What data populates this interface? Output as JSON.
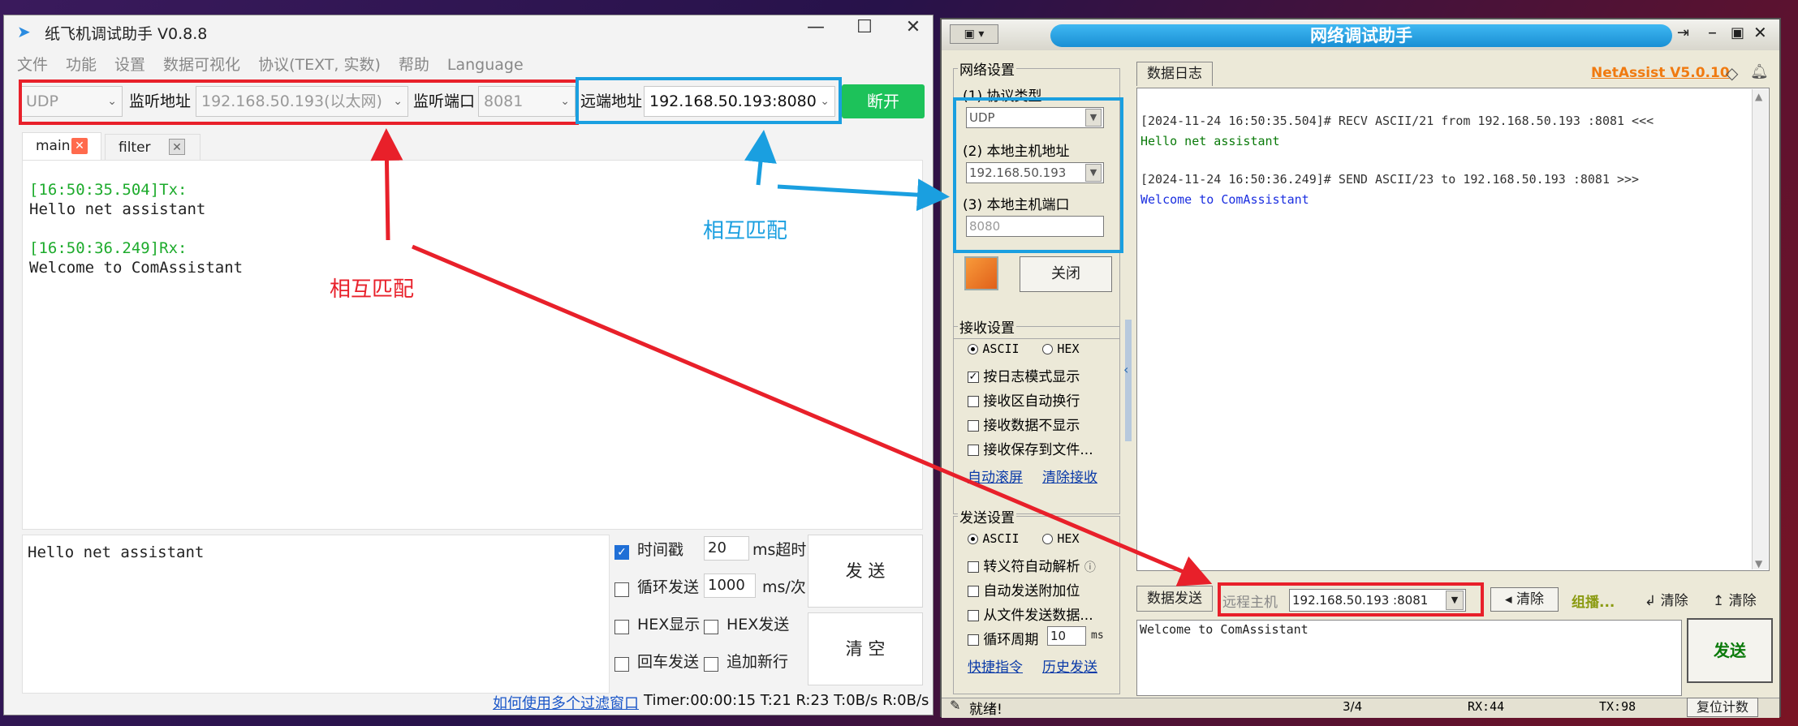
{
  "left": {
    "title": "纸飞机调试助手 V0.8.8",
    "menu": [
      "文件",
      "功能",
      "设置",
      "数据可视化",
      "协议(TEXT, 实数)",
      "帮助",
      "Language"
    ],
    "protocol": "UDP",
    "listen_addr_label": "监听地址",
    "listen_addr": "192.168.50.193(以太网)",
    "listen_port_label": "监听端口",
    "listen_port": "8081",
    "remote_addr_label": "远端地址",
    "remote_addr": "192.168.50.193:8080",
    "disconnect_label": "断开",
    "tabs": [
      "main",
      "filter"
    ],
    "log": [
      {
        "time": "[16:50:35.504]Tx:",
        "text": "Hello net assistant"
      },
      {
        "time": "[16:50:36.249]Rx:",
        "text": "Welcome to ComAssistant"
      }
    ],
    "send_text": "Hello net assistant",
    "timestamp_label": "时间戳",
    "timeout_value": "20",
    "timeout_unit": "ms超时",
    "loop_label": "循环发送",
    "loop_value": "1000",
    "loop_unit": "ms/次",
    "hex_show_label": "HEX显示",
    "hex_send_label": "HEX发送",
    "cr_label": "回车发送",
    "newline_label": "追加新行",
    "send_label": "发 送",
    "clear_label": "清 空",
    "filter_link": "如何使用多个过滤窗口",
    "status": "Timer:00:00:15 T:21 R:23  T:0B/s R:0B/s"
  },
  "right": {
    "title": "网络调试助手",
    "net_settings": "网络设置",
    "proto_label": "(1) 协议类型",
    "proto_value": "UDP",
    "host_label": "(2) 本地主机地址",
    "host_value": "192.168.50.193",
    "port_label": "(3) 本地主机端口",
    "port_value": "8080",
    "close_label": "关闭",
    "recv_settings": "接收设置",
    "ascii": "ASCII",
    "hex": "HEX",
    "recv_opts": [
      "按日志模式显示",
      "接收区自动换行",
      "接收数据不显示",
      "接收保存到文件..."
    ],
    "auto_scroll": "自动滚屏",
    "clear_recv": "清除接收",
    "send_settings": "发送设置",
    "send_opts": [
      "转义符自动解析",
      "自动发送附加位",
      "从文件发送数据...",
      "循环周期"
    ],
    "cycle_value": "10",
    "cycle_unit": "ms",
    "shortcut": "快捷指令",
    "history": "历史发送",
    "log_tab": "数据日志",
    "brand": "NetAssist V5.0.10",
    "log_lines": [
      {
        "head": "[2024-11-24 16:50:35.504]# RECV ASCII/21 from 192.168.50.193 :8081 <<<",
        "body": "Hello net assistant",
        "color": "#0a7a0a"
      },
      {
        "head": "[2024-11-24 16:50:36.249]# SEND ASCII/23 to 192.168.50.193 :8081 >>>",
        "body": "Welcome to ComAssistant",
        "color": "#1a2ee0"
      }
    ],
    "send_tab": "数据发送",
    "remote_label": "远程主机",
    "remote_value": "192.168.50.193 :8081",
    "clear1": "清除",
    "group": "组播...",
    "clear2": "清除",
    "clear3": "清除",
    "send_text": "Welcome to ComAssistant",
    "send_btn": "发送",
    "ready": "就绪!",
    "count": "3/4",
    "rx": "RX:44",
    "tx": "TX:98",
    "reset": "复位计数"
  },
  "annotations": {
    "match_red": "相互匹配",
    "match_blue": "相互匹配"
  },
  "colors": {
    "red": "#e8202a",
    "blue": "#1a9fe0",
    "green": "#1dc25a"
  }
}
